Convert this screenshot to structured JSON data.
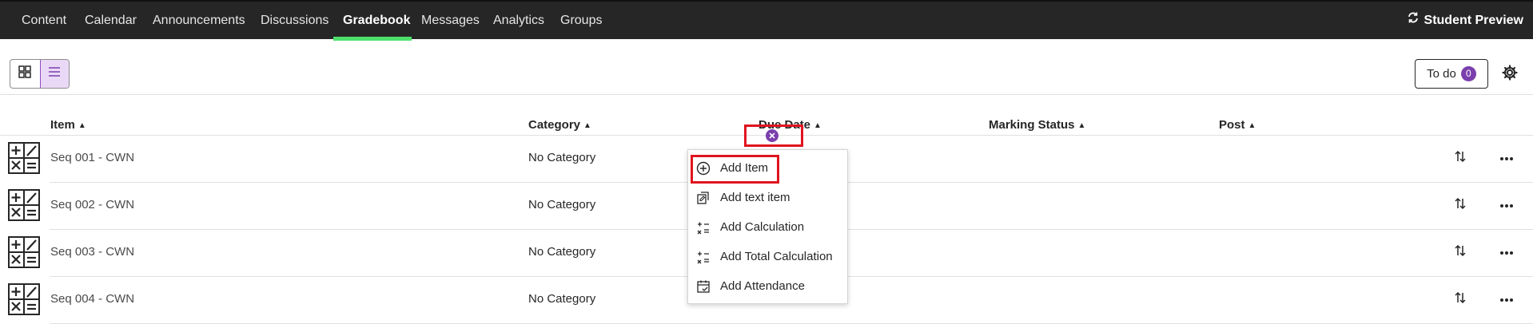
{
  "nav": {
    "tabs": [
      {
        "label": "Content"
      },
      {
        "label": "Calendar"
      },
      {
        "label": "Announcements"
      },
      {
        "label": "Discussions"
      },
      {
        "label": "Gradebook",
        "active": true
      },
      {
        "label": "Messages"
      },
      {
        "label": "Analytics"
      },
      {
        "label": "Groups"
      }
    ],
    "student_preview": "Student Preview",
    "active_underline_color": "#4ee06b"
  },
  "toolbar": {
    "todo_label": "To do",
    "todo_count": "0"
  },
  "columns": {
    "item": "Item",
    "category": "Category",
    "due_date": "Due Date",
    "marking_status": "Marking Status",
    "post": "Post"
  },
  "rows": [
    {
      "name": "Seq 001 - CWN",
      "category": "No Category"
    },
    {
      "name": "Seq 002 - CWN",
      "category": "No Category"
    },
    {
      "name": "Seq 003 - CWN",
      "category": "No Category"
    },
    {
      "name": "Seq 004 - CWN",
      "category": "No Category"
    }
  ],
  "add_menu": {
    "items": [
      {
        "label": "Add Item",
        "icon": "plus-circle-icon"
      },
      {
        "label": "Add text item",
        "icon": "text-item-icon"
      },
      {
        "label": "Add Calculation",
        "icon": "calculation-icon"
      },
      {
        "label": "Add Total Calculation",
        "icon": "total-calculation-icon"
      },
      {
        "label": "Add Attendance",
        "icon": "attendance-icon"
      }
    ]
  },
  "colors": {
    "accent": "#7b3fad",
    "highlight": "#e0141e",
    "nav_bg": "#262626"
  }
}
